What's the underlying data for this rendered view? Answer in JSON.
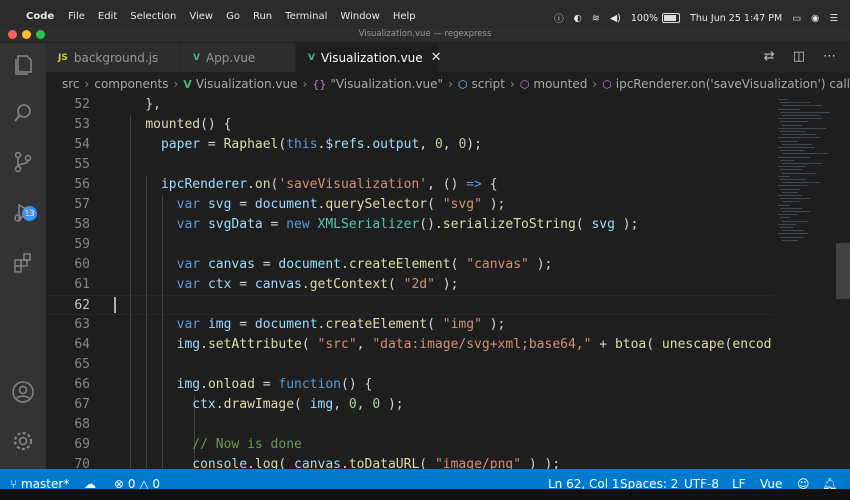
{
  "menubar": {
    "app_name": "Code",
    "items": [
      "File",
      "Edit",
      "Selection",
      "View",
      "Go",
      "Run",
      "Terminal",
      "Window",
      "Help"
    ],
    "battery": "100%",
    "datetime": "Thu Jun 25  1:47 PM"
  },
  "window": {
    "title": "Visualization.vue — regexpress"
  },
  "tabs": [
    {
      "label": "background.js",
      "ext": "JS",
      "ext_color": "#cbcb41",
      "active": false
    },
    {
      "label": "App.vue",
      "ext": "V",
      "ext_color": "#41b883",
      "active": false
    },
    {
      "label": "Visualization.vue",
      "ext": "V",
      "ext_color": "#41b883",
      "active": true
    }
  ],
  "breadcrumb": [
    "src",
    "components",
    "Visualization.vue",
    "\"Visualization.vue\"",
    "script",
    "mounted",
    "ipcRenderer.on('saveVisualization') callback"
  ],
  "activity": {
    "scm_badge": "13"
  },
  "editor": {
    "lines": [
      {
        "n": "52",
        "tokens": [
          [
            "    },",
            "txt"
          ]
        ]
      },
      {
        "n": "53",
        "tokens": [
          [
            "    ",
            "txt"
          ],
          [
            "mounted",
            "fn"
          ],
          [
            "() {",
            "txt"
          ]
        ]
      },
      {
        "n": "54",
        "tokens": [
          [
            "      ",
            "txt"
          ],
          [
            "paper",
            "var"
          ],
          [
            " = ",
            "txt"
          ],
          [
            "Raphael",
            "fn"
          ],
          [
            "(",
            "txt"
          ],
          [
            "this",
            "kw"
          ],
          [
            ".",
            "txt"
          ],
          [
            "$refs",
            "var"
          ],
          [
            ".",
            "txt"
          ],
          [
            "output",
            "var"
          ],
          [
            ", ",
            "txt"
          ],
          [
            "0",
            "num"
          ],
          [
            ", ",
            "txt"
          ],
          [
            "0",
            "num"
          ],
          [
            ");",
            "txt"
          ]
        ]
      },
      {
        "n": "55",
        "tokens": []
      },
      {
        "n": "56",
        "tokens": [
          [
            "      ",
            "txt"
          ],
          [
            "ipcRenderer",
            "var"
          ],
          [
            ".",
            "txt"
          ],
          [
            "on",
            "fn"
          ],
          [
            "(",
            "txt"
          ],
          [
            "'saveVisualization'",
            "str"
          ],
          [
            ", () ",
            "txt"
          ],
          [
            "=>",
            "kw"
          ],
          [
            " {",
            "txt"
          ]
        ]
      },
      {
        "n": "57",
        "tokens": [
          [
            "        ",
            "txt"
          ],
          [
            "var",
            "kw"
          ],
          [
            " ",
            "txt"
          ],
          [
            "svg",
            "var"
          ],
          [
            " = ",
            "txt"
          ],
          [
            "document",
            "var"
          ],
          [
            ".",
            "txt"
          ],
          [
            "querySelector",
            "fn"
          ],
          [
            "( ",
            "txt"
          ],
          [
            "\"svg\"",
            "str"
          ],
          [
            " );",
            "txt"
          ]
        ]
      },
      {
        "n": "58",
        "tokens": [
          [
            "        ",
            "txt"
          ],
          [
            "var",
            "kw"
          ],
          [
            " ",
            "txt"
          ],
          [
            "svgData",
            "var"
          ],
          [
            " = ",
            "txt"
          ],
          [
            "new",
            "kw"
          ],
          [
            " ",
            "txt"
          ],
          [
            "XMLSerializer",
            "cls"
          ],
          [
            "().",
            "txt"
          ],
          [
            "serializeToString",
            "fn"
          ],
          [
            "( ",
            "txt"
          ],
          [
            "svg",
            "var"
          ],
          [
            " );",
            "txt"
          ]
        ]
      },
      {
        "n": "59",
        "tokens": []
      },
      {
        "n": "60",
        "tokens": [
          [
            "        ",
            "txt"
          ],
          [
            "var",
            "kw"
          ],
          [
            " ",
            "txt"
          ],
          [
            "canvas",
            "var"
          ],
          [
            " = ",
            "txt"
          ],
          [
            "document",
            "var"
          ],
          [
            ".",
            "txt"
          ],
          [
            "createElement",
            "fn"
          ],
          [
            "( ",
            "txt"
          ],
          [
            "\"canvas\"",
            "str"
          ],
          [
            " );",
            "txt"
          ]
        ]
      },
      {
        "n": "61",
        "tokens": [
          [
            "        ",
            "txt"
          ],
          [
            "var",
            "kw"
          ],
          [
            " ",
            "txt"
          ],
          [
            "ctx",
            "var"
          ],
          [
            " = ",
            "txt"
          ],
          [
            "canvas",
            "var"
          ],
          [
            ".",
            "txt"
          ],
          [
            "getContext",
            "fn"
          ],
          [
            "( ",
            "txt"
          ],
          [
            "\"2d\"",
            "str"
          ],
          [
            " );",
            "txt"
          ]
        ]
      },
      {
        "n": "62",
        "tokens": [],
        "current": true
      },
      {
        "n": "63",
        "tokens": [
          [
            "        ",
            "txt"
          ],
          [
            "var",
            "kw"
          ],
          [
            " ",
            "txt"
          ],
          [
            "img",
            "var"
          ],
          [
            " = ",
            "txt"
          ],
          [
            "document",
            "var"
          ],
          [
            ".",
            "txt"
          ],
          [
            "createElement",
            "fn"
          ],
          [
            "( ",
            "txt"
          ],
          [
            "\"img\"",
            "str"
          ],
          [
            " );",
            "txt"
          ]
        ]
      },
      {
        "n": "64",
        "tokens": [
          [
            "        ",
            "txt"
          ],
          [
            "img",
            "var"
          ],
          [
            ".",
            "txt"
          ],
          [
            "setAttribute",
            "fn"
          ],
          [
            "( ",
            "txt"
          ],
          [
            "\"src\"",
            "str"
          ],
          [
            ", ",
            "txt"
          ],
          [
            "\"data:image/svg+xml;base64,\"",
            "str"
          ],
          [
            " + ",
            "txt"
          ],
          [
            "btoa",
            "fn"
          ],
          [
            "( ",
            "txt"
          ],
          [
            "unescape",
            "fn"
          ],
          [
            "(",
            "txt"
          ],
          [
            "encod",
            "fn"
          ]
        ]
      },
      {
        "n": "65",
        "tokens": []
      },
      {
        "n": "66",
        "tokens": [
          [
            "        ",
            "txt"
          ],
          [
            "img",
            "var"
          ],
          [
            ".",
            "txt"
          ],
          [
            "onload",
            "fn"
          ],
          [
            " = ",
            "txt"
          ],
          [
            "function",
            "kw"
          ],
          [
            "() {",
            "txt"
          ]
        ]
      },
      {
        "n": "67",
        "tokens": [
          [
            "          ",
            "txt"
          ],
          [
            "ctx",
            "var"
          ],
          [
            ".",
            "txt"
          ],
          [
            "drawImage",
            "fn"
          ],
          [
            "( ",
            "txt"
          ],
          [
            "img",
            "var"
          ],
          [
            ", ",
            "txt"
          ],
          [
            "0",
            "num"
          ],
          [
            ", ",
            "txt"
          ],
          [
            "0",
            "num"
          ],
          [
            " );",
            "txt"
          ]
        ]
      },
      {
        "n": "68",
        "tokens": []
      },
      {
        "n": "69",
        "tokens": [
          [
            "          ",
            "txt"
          ],
          [
            "// Now is done",
            "cmt"
          ]
        ]
      },
      {
        "n": "70",
        "tokens": [
          [
            "          ",
            "txt"
          ],
          [
            "console",
            "var"
          ],
          [
            ".",
            "txt"
          ],
          [
            "log",
            "fn"
          ],
          [
            "( ",
            "txt"
          ],
          [
            "canvas",
            "var"
          ],
          [
            ".",
            "txt"
          ],
          [
            "toDataURL",
            "fn"
          ],
          [
            "( ",
            "txt"
          ],
          [
            "\"image/png\"",
            "str"
          ],
          [
            " ) );",
            "txt"
          ]
        ]
      }
    ]
  },
  "statusbar": {
    "branch": "master*",
    "errors": "0",
    "warnings": "0",
    "position": "Ln 62, Col 1",
    "spaces": "Spaces: 2",
    "encoding": "UTF-8",
    "eol": "LF",
    "language": "Vue"
  }
}
